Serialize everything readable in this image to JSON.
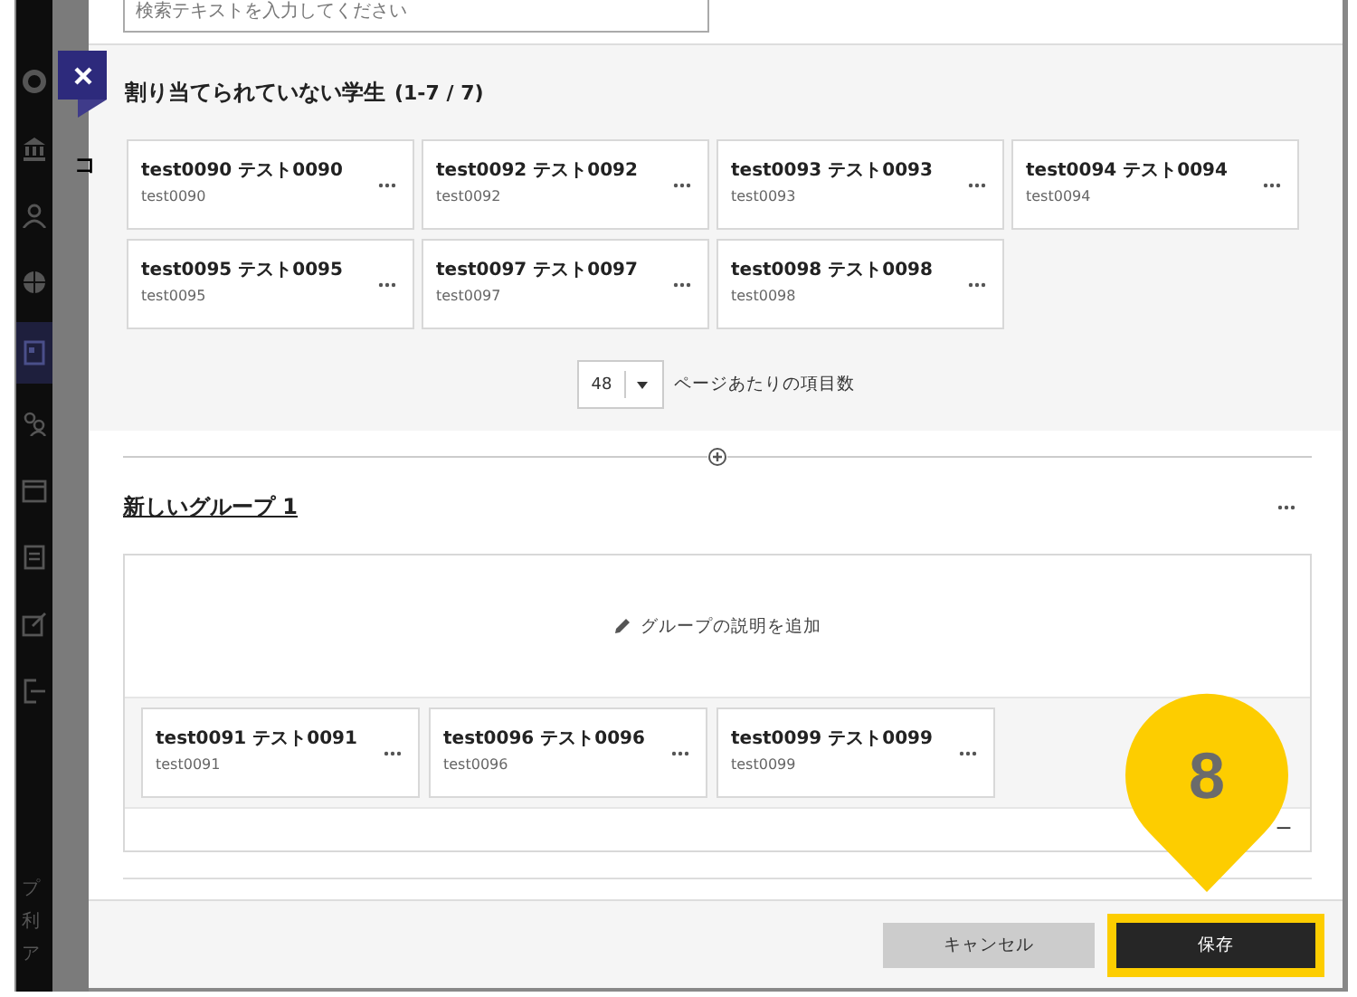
{
  "search": {
    "placeholder": "検索テキストを入力してください"
  },
  "background": {
    "nav_fragment": "コ",
    "footer_fragments": [
      "プ",
      "利",
      "ア"
    ]
  },
  "unassigned": {
    "title": "割り当てられていない学生",
    "count": "(1-7 / 7)",
    "students": [
      {
        "name": "test0090 テスト0090",
        "id": "test0090"
      },
      {
        "name": "test0092 テスト0092",
        "id": "test0092"
      },
      {
        "name": "test0093 テスト0093",
        "id": "test0093"
      },
      {
        "name": "test0094 テスト0094",
        "id": "test0094"
      },
      {
        "name": "test0095 テスト0095",
        "id": "test0095"
      },
      {
        "name": "test0097 テスト0097",
        "id": "test0097"
      },
      {
        "name": "test0098 テスト0098",
        "id": "test0098"
      }
    ],
    "page_size": "48",
    "page_size_label": "ページあたりの項目数"
  },
  "group": {
    "title": "新しいグループ 1",
    "description_placeholder": "グループの説明を追加",
    "members": [
      {
        "name": "test0091 テスト0091",
        "id": "test0091"
      },
      {
        "name": "test0096 テスト0096",
        "id": "test0096"
      },
      {
        "name": "test0099 テスト0099",
        "id": "test0099"
      }
    ],
    "trailing_text": "ー"
  },
  "buttons": [
    {
      "label": "キャンセル",
      "kind": "secondary"
    },
    {
      "label": "保存",
      "kind": "primary",
      "highlighted": true
    }
  ],
  "callout": {
    "number": "8"
  }
}
